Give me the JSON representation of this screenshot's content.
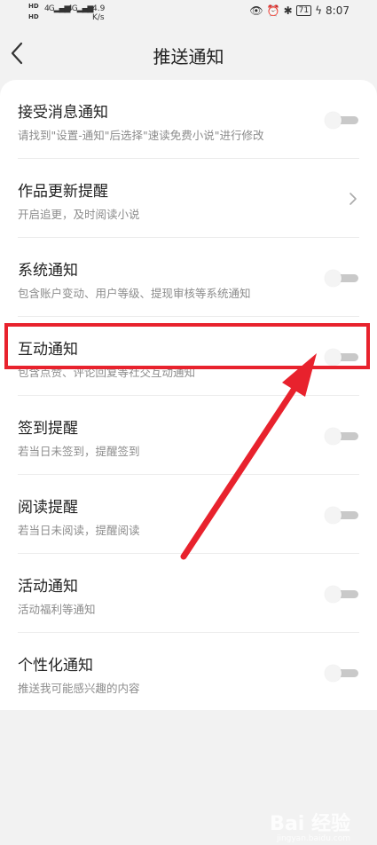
{
  "status_bar": {
    "hd1": "HD",
    "hd2": "HD",
    "signal1": "4G",
    "signal2": "4G",
    "speed_value": "4.9",
    "speed_unit": "K/s",
    "battery": "71",
    "time": "8:07"
  },
  "header": {
    "title": "推送通知"
  },
  "settings": [
    {
      "title": "接受消息通知",
      "subtitle": "请找到\"设置-通知\"后选择\"速读免费小说\"进行修改",
      "control": "toggle"
    },
    {
      "title": "作品更新提醒",
      "subtitle": "开启追更，及时阅读小说",
      "control": "chevron"
    },
    {
      "title": "系统通知",
      "subtitle": "包含账户变动、用户等级、提现审核等系统通知",
      "control": "toggle"
    },
    {
      "title": "互动通知",
      "subtitle": "包含点赞、评论回复等社交互动通知",
      "control": "toggle"
    },
    {
      "title": "签到提醒",
      "subtitle": "若当日未签到，提醒签到",
      "control": "toggle"
    },
    {
      "title": "阅读提醒",
      "subtitle": "若当日未阅读，提醒阅读",
      "control": "toggle"
    },
    {
      "title": "活动通知",
      "subtitle": "活动福利等通知",
      "control": "toggle"
    },
    {
      "title": "个性化通知",
      "subtitle": "推送我可能感兴趣的内容",
      "control": "toggle"
    }
  ],
  "watermark": {
    "text": "Bai 经验",
    "sub": "jingyan.baidu.com"
  },
  "colors": {
    "annotation": "#e8222d",
    "toggle_track": "#c9c9c9",
    "background": "#f2f2f2"
  }
}
